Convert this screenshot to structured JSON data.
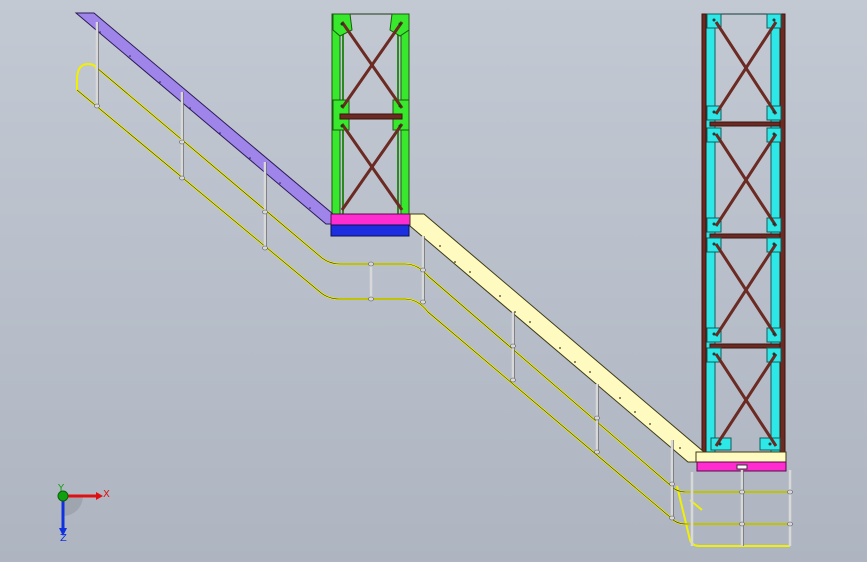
{
  "viewport": {
    "background": "#bcc3ce"
  },
  "triad": {
    "x_label": "X",
    "y_label": "Y",
    "z_label": "Z",
    "x_color": "#e01010",
    "y_color": "#10a010",
    "z_color": "#1030e0"
  },
  "colors": {
    "upper_stair": "#9f85ea",
    "lower_stair": "#fffbc0",
    "tower_a": "#38e82c",
    "tower_b": "#2ee8e8",
    "brace": "#6b2a22",
    "handrail": "#f0f000",
    "post": "#d8d8d8",
    "landing_top": "#ff2ccf",
    "landing_bottom": "#1c2fe0"
  }
}
